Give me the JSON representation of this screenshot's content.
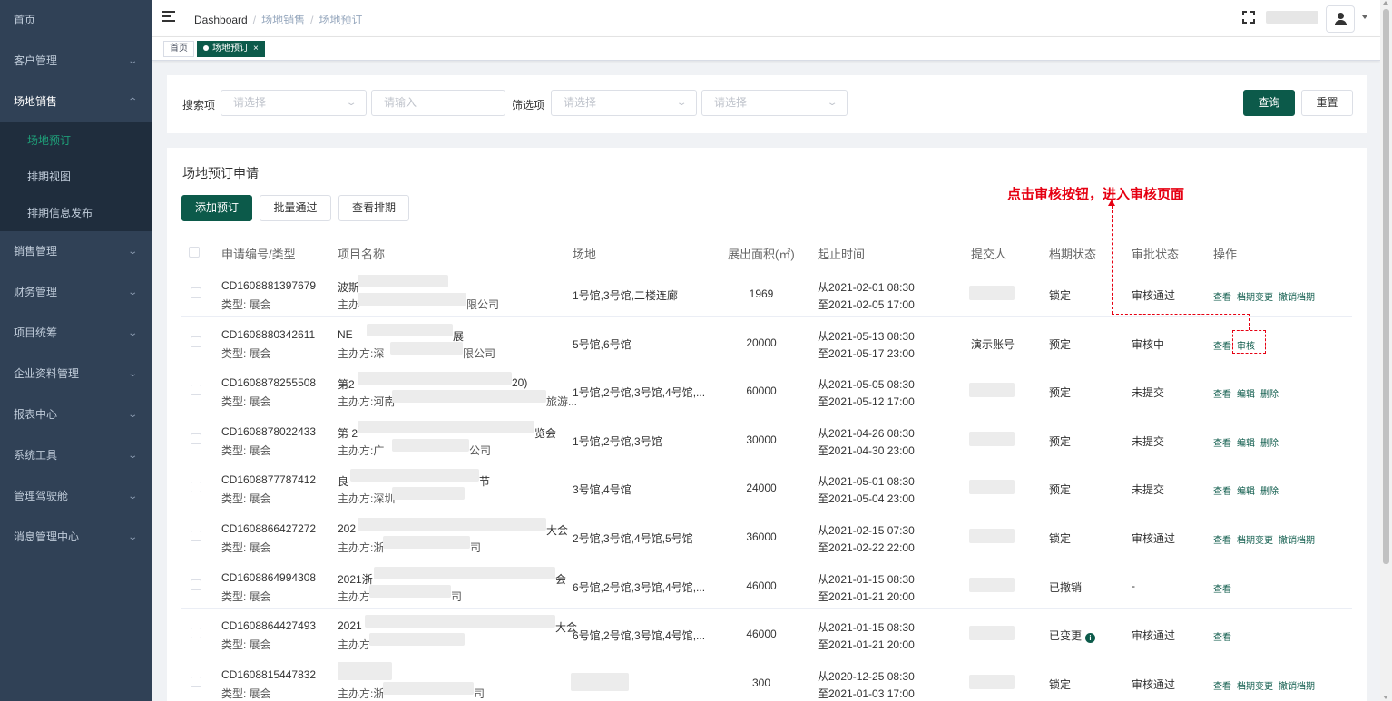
{
  "sidebar": {
    "items": [
      {
        "label": "首页"
      },
      {
        "label": "客户管理"
      },
      {
        "label": "场地销售"
      },
      {
        "label": "销售管理"
      },
      {
        "label": "财务管理"
      },
      {
        "label": "项目统筹"
      },
      {
        "label": "企业资料管理"
      },
      {
        "label": "报表中心"
      },
      {
        "label": "系统工具"
      },
      {
        "label": "管理驾驶舱"
      },
      {
        "label": "消息管理中心"
      }
    ],
    "sub_items": [
      {
        "label": "场地预订"
      },
      {
        "label": "排期视图"
      },
      {
        "label": "排期信息发布"
      }
    ]
  },
  "header": {
    "breadcrumb": [
      "Dashboard",
      "场地销售",
      "场地预订"
    ]
  },
  "tags": [
    {
      "label": "首页"
    },
    {
      "label": "场地预订"
    }
  ],
  "search": {
    "search_label": "搜索项",
    "search_select_placeholder": "请选择",
    "search_input_placeholder": "请输入",
    "filter_label": "筛选项",
    "filter_select1_placeholder": "请选择",
    "filter_select2_placeholder": "请选择",
    "query_button": "查询",
    "reset_button": "重置"
  },
  "section": {
    "title": "场地预订申请",
    "add_button": "添加预订",
    "batch_button": "批量通过",
    "view_schedule_button": "查看排期"
  },
  "table": {
    "columns": [
      "申请编号/类型",
      "项目名称",
      "场地",
      "展出面积(㎡)",
      "起止时间",
      "提交人",
      "档期状态",
      "审批状态",
      "操作"
    ],
    "rows": [
      {
        "id": "CD1608881397679",
        "type": "类型: 展会",
        "name": "波斯",
        "organizer": "主办",
        "organizer_tail": "限公司",
        "venue": "1号馆,3号馆,二楼连廊",
        "area": "1969",
        "start": "从2021-02-01 08:30",
        "end": "至2021-02-05 17:00",
        "submitter": "",
        "schedule": "锁定",
        "approval": "审核通过",
        "ops": [
          "查看",
          "档期变更",
          "撤销档期"
        ]
      },
      {
        "id": "CD1608880342611",
        "type": "类型: 展会",
        "name": "NE",
        "name_tail": "展",
        "organizer": "主办方:深",
        "organizer_tail": "限公司",
        "venue": "5号馆,6号馆",
        "area": "20000",
        "start": "从2021-05-13 08:30",
        "end": "至2021-05-17 23:00",
        "submitter": "演示账号",
        "schedule": "预定",
        "approval": "审核中",
        "ops": [
          "查看",
          "审核"
        ]
      },
      {
        "id": "CD1608878255508",
        "type": "类型: 展会",
        "name": "第2",
        "name_tail": "20)",
        "organizer": "主办方:河南",
        "organizer_tail": "旅游...",
        "venue": "1号馆,2号馆,3号馆,4号馆,...",
        "area": "60000",
        "start": "从2021-05-05 08:30",
        "end": "至2021-05-12 17:00",
        "submitter": "",
        "schedule": "预定",
        "approval": "未提交",
        "ops": [
          "查看",
          "编辑",
          "删除"
        ]
      },
      {
        "id": "CD1608878022433",
        "type": "类型: 展会",
        "name": "第 2",
        "name_tail": "览会",
        "organizer": "主办方:广",
        "organizer_tail": "公司",
        "venue": "1号馆,2号馆,3号馆",
        "area": "30000",
        "start": "从2021-04-26 08:30",
        "end": "至2021-04-30 23:00",
        "submitter": "",
        "schedule": "预定",
        "approval": "未提交",
        "ops": [
          "查看",
          "编辑",
          "删除"
        ]
      },
      {
        "id": "CD1608877787412",
        "type": "类型: 展会",
        "name": "良",
        "name_tail": "节",
        "organizer": "主办方:深圳",
        "organizer_tail": "",
        "venue": "3号馆,4号馆",
        "area": "24000",
        "start": "从2021-05-01 08:30",
        "end": "至2021-05-04 23:00",
        "submitter": "",
        "schedule": "预定",
        "approval": "未提交",
        "ops": [
          "查看",
          "编辑",
          "删除"
        ]
      },
      {
        "id": "CD1608866427272",
        "type": "类型: 展会",
        "name": "202",
        "name_tail": "大会",
        "organizer": "主办方:浙",
        "organizer_tail": "司",
        "venue": "2号馆,3号馆,4号馆,5号馆",
        "area": "36000",
        "start": "从2021-02-15 07:30",
        "end": "至2021-02-22 22:00",
        "submitter": "",
        "schedule": "锁定",
        "approval": "审核通过",
        "ops": [
          "查看",
          "档期变更",
          "撤销档期"
        ]
      },
      {
        "id": "CD1608864994308",
        "type": "类型: 展会",
        "name": "2021浙",
        "name_tail": "会",
        "organizer": "主办方",
        "organizer_tail": "司",
        "venue": "6号馆,2号馆,3号馆,4号馆,...",
        "area": "46000",
        "start": "从2021-01-15 08:30",
        "end": "至2021-01-21 20:00",
        "submitter": "",
        "schedule": "已撤销",
        "approval": "-",
        "ops": [
          "查看"
        ]
      },
      {
        "id": "CD1608864427493",
        "type": "类型: 展会",
        "name": "2021",
        "name_tail": "大会",
        "organizer": "主办方",
        "organizer_tail": "",
        "venue": "6号馆,2号馆,3号馆,4号馆,...",
        "area": "46000",
        "start": "从2021-01-15 08:30",
        "end": "至2021-01-21 20:00",
        "submitter": "",
        "schedule": "已变更",
        "approval": "审核通过",
        "ops": [
          "查看"
        ]
      },
      {
        "id": "CD1608815447832",
        "type": "类型: 展会",
        "name": "",
        "name_tail": "",
        "organizer": "主办方:浙",
        "organizer_tail": "司",
        "venue": "",
        "area": "300",
        "start": "从2020-12-25 08:30",
        "end": "至2021-01-03 17:00",
        "submitter": "",
        "schedule": "锁定",
        "approval": "审核通过",
        "ops": [
          "查看",
          "档期变更",
          "撤销档期"
        ]
      }
    ]
  },
  "annotation": {
    "text": "点击审核按钮，进入审核页面",
    "color": "#e60012"
  },
  "colors": {
    "sidebar_bg": "#304156",
    "primary": "#0c5a4a",
    "active_menu": "#1e9e78"
  }
}
